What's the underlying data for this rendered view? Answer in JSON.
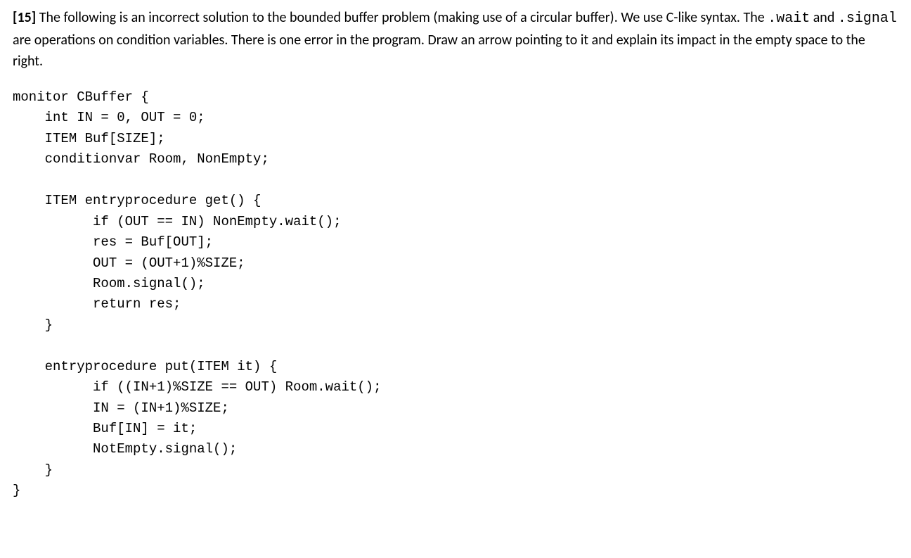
{
  "question": {
    "number": "[15]",
    "text_part1": " The following is an incorrect solution to the bounded buffer problem (making use of a circular buffer). We use C-like syntax. The ",
    "code1": ".wait",
    "text_part2": " and ",
    "code2": ".signal",
    "text_part3": " are operations on condition variables. There is one error in the program. Draw an arrow pointing to it and explain its impact in the empty space to the right."
  },
  "code": {
    "line1": "monitor CBuffer {",
    "line2": "    int IN = 0, OUT = 0;",
    "line3": "    ITEM Buf[SIZE];",
    "line4": "    conditionvar Room, NonEmpty;",
    "line5": "",
    "line6": "    ITEM entryprocedure get() {",
    "line7": "          if (OUT == IN) NonEmpty.wait();",
    "line8": "          res = Buf[OUT];",
    "line9": "          OUT = (OUT+1)%SIZE;",
    "line10": "          Room.signal();",
    "line11": "          return res;",
    "line12": "    }",
    "line13": "",
    "line14": "    entryprocedure put(ITEM it) {",
    "line15": "          if ((IN+1)%SIZE == OUT) Room.wait();",
    "line16": "          IN = (IN+1)%SIZE;",
    "line17": "          Buf[IN] = it;",
    "line18": "          NotEmpty.signal();",
    "line19": "    }",
    "line20": "}"
  }
}
